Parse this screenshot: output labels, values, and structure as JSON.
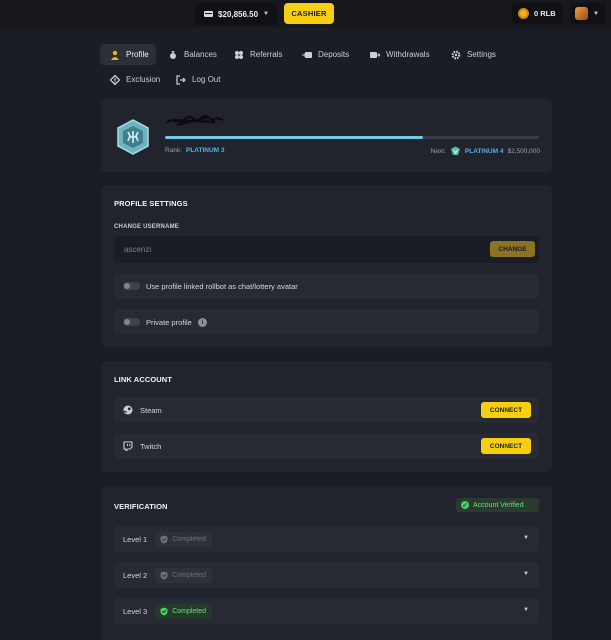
{
  "topbar": {
    "balance": "$20,856.50",
    "cashier_label": "CASHIER",
    "rlb_balance": "0 RLB"
  },
  "tabs": [
    {
      "label": "Profile",
      "icon": "user-icon",
      "active": true
    },
    {
      "label": "Balances",
      "icon": "money-bag-icon"
    },
    {
      "label": "Referrals",
      "icon": "referrals-icon"
    },
    {
      "label": "Deposits",
      "icon": "deposit-icon"
    },
    {
      "label": "Withdrawals",
      "icon": "withdrawal-icon"
    },
    {
      "label": "Settings",
      "icon": "gear-icon"
    },
    {
      "label": "Exclusion",
      "icon": "exclusion-icon"
    },
    {
      "label": "Log Out",
      "icon": "logout-icon"
    }
  ],
  "rank": {
    "rank_label": "Rank:",
    "rank_name": "PLATINUM 3",
    "next_label": "Next:",
    "next_rank": "PLATINUM 4",
    "next_amount": "$2,500,000",
    "progress_fraction": 0.69
  },
  "profile_settings": {
    "title": "PROFILE SETTINGS",
    "change_username_label": "CHANGE USERNAME",
    "username_value": "ascenzi",
    "change_button": "CHANGE",
    "toggle_avatar_label": "Use profile linked rollbot as chat/lottery avatar",
    "toggle_private_label": "Private profile"
  },
  "link_account": {
    "title": "LINK ACCOUNT",
    "items": [
      {
        "name": "Steam",
        "icon": "steam-icon",
        "button": "CONNECT"
      },
      {
        "name": "Twitch",
        "icon": "twitch-icon",
        "button": "CONNECT"
      }
    ]
  },
  "verification": {
    "title": "VERIFICATION",
    "badge": "Account Verified",
    "levels": [
      {
        "label": "Level 1",
        "status": "Completed",
        "done": false
      },
      {
        "label": "Level 2",
        "status": "Completed",
        "done": false
      },
      {
        "label": "Level 3",
        "status": "Completed",
        "done": true
      }
    ]
  },
  "colors": {
    "accent": "#f5cf10",
    "rank_blue": "#4fb4ea",
    "verified_green": "#6ae07e"
  }
}
